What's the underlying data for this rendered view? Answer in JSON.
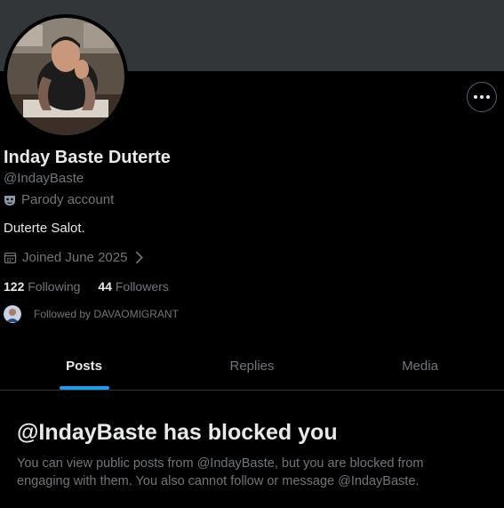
{
  "profile": {
    "name": "Inday Baste Duterte",
    "handle": "@IndayBaste",
    "parody_label": "Parody account",
    "bio": "Duterte Salot.",
    "joined": "Joined June 2025",
    "following_count": "122",
    "following_label": "Following",
    "followers_count": "44",
    "followers_label": "Followers",
    "followed_by": "Followed by DAVAOMIGRANT"
  },
  "tabs": [
    {
      "label": "Posts",
      "active": true
    },
    {
      "label": "Replies",
      "active": false
    },
    {
      "label": "Media",
      "active": false
    }
  ],
  "blocked": {
    "title": "@IndayBaste has blocked you",
    "message": "You can view public posts from @IndayBaste, but you are blocked from engaging with them. You also cannot follow or message @IndayBaste."
  },
  "icons": {
    "more": "more-icon",
    "parody": "mask-icon",
    "calendar": "calendar-icon",
    "chevron": "chevron-right-icon"
  },
  "colors": {
    "background": "#000000",
    "banner": "#333639",
    "accent": "#1d9bf0",
    "text": "#e7e9ea",
    "muted": "#71767b"
  }
}
